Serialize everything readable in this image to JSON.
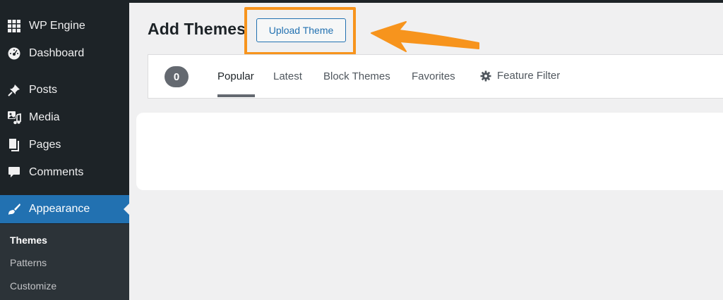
{
  "sidebar": {
    "items": [
      {
        "label": "WP Engine",
        "icon": "wp-engine-icon"
      },
      {
        "label": "Dashboard",
        "icon": "dashboard-gauge-icon"
      },
      {
        "label": "Posts",
        "icon": "pushpin-icon"
      },
      {
        "label": "Media",
        "icon": "media-icon"
      },
      {
        "label": "Pages",
        "icon": "pages-icon"
      },
      {
        "label": "Comments",
        "icon": "comment-bubble-icon"
      },
      {
        "label": "Appearance",
        "icon": "paintbrush-icon",
        "active": true
      }
    ],
    "submenu": [
      {
        "label": "Themes",
        "current": true
      },
      {
        "label": "Patterns"
      },
      {
        "label": "Customize"
      }
    ]
  },
  "main": {
    "title": "Add Themes",
    "upload_button": "Upload Theme",
    "theme_count": "0",
    "tabs": [
      {
        "label": "Popular",
        "current": true
      },
      {
        "label": "Latest"
      },
      {
        "label": "Block Themes"
      },
      {
        "label": "Favorites"
      },
      {
        "label": "Feature Filter",
        "icon": "gear-icon"
      }
    ]
  },
  "colors": {
    "sidebar_bg": "#1d2327",
    "active_item": "#2271b1",
    "highlight": "#f7941d",
    "link_blue": "#2271b1"
  }
}
